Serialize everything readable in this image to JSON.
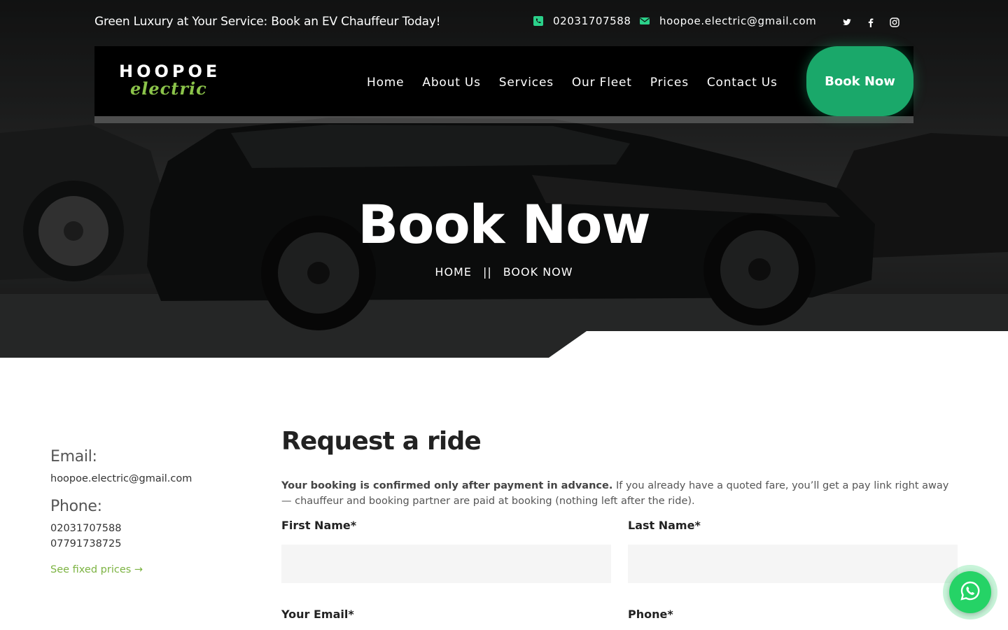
{
  "topbar": {
    "tagline": "Green Luxury at Your Service: Book an EV Chauffeur Today!",
    "phone": "02031707588",
    "email": "hoopoe.electric@gmail.com",
    "socials": [
      "twitter-icon",
      "facebook-icon",
      "instagram-icon"
    ]
  },
  "brand": {
    "name_top": "HOOPOE",
    "name_bottom": "electric"
  },
  "nav": {
    "items": [
      "Home",
      "About Us",
      "Services",
      "Our Fleet",
      "Prices",
      "Contact Us"
    ],
    "cta": "Book Now"
  },
  "hero": {
    "title": "Book Now",
    "breadcrumb_home": "HOME",
    "breadcrumb_sep": "||",
    "breadcrumb_current": "BOOK NOW"
  },
  "info": {
    "email_label": "Email:",
    "email_value": "hoopoe.electric@gmail.com",
    "phone_label": "Phone:",
    "phone_1": "02031707588",
    "phone_2": "07791738725",
    "prices_link": "See fixed prices →"
  },
  "form": {
    "title": "Request a ride",
    "note_bold": "Your booking is confirmed only after payment in advance.",
    "note_rest": " If you already have a quoted fare, you’ll get a pay link right away — chauffeur and booking partner are paid at booking (nothing left after the ride).",
    "first_name_label": "First Name*",
    "last_name_label": "Last Name*",
    "email_label": "Your Email*",
    "phone_label": "Phone*"
  },
  "colors": {
    "accent_green": "#1aa86a",
    "logo_green": "#8bc34a",
    "link_green": "#7cb342",
    "whatsapp": "#25d366"
  }
}
